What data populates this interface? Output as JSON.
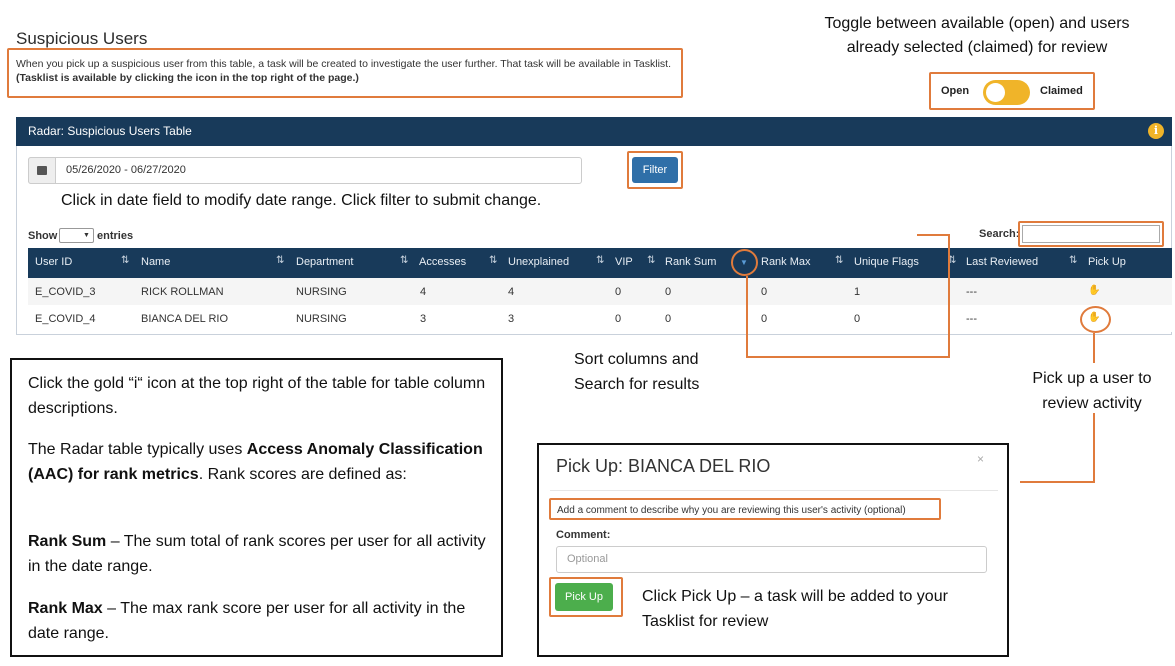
{
  "page": {
    "title": "Suspicious Users",
    "intro_line1": "When you pick up a suspicious user from this table, a task will be created to investigate the user further. That task will be available in Tasklist.",
    "intro_line2": "(Tasklist is available by clicking the icon in the top right of the page.)"
  },
  "toggle": {
    "callout": "Toggle between available (open) and users already selected (claimed) for review",
    "open_label": "Open",
    "claimed_label": "Claimed"
  },
  "panel": {
    "title": "Radar: Suspicious Users Table",
    "info_icon_glyph": "i"
  },
  "filters": {
    "date_range": "05/26/2020 - 06/27/2020",
    "filter_label": "Filter",
    "instructions": "Click in date field to modify date range.  Click filter to submit change."
  },
  "table_controls": {
    "show_label": "Show",
    "entries_label": "entries",
    "search_label": "Search:",
    "search_value": ""
  },
  "table": {
    "columns": [
      "User ID",
      "Name",
      "Department",
      "Accesses",
      "Unexplained",
      "VIP",
      "Rank Sum",
      "Rank Max",
      "Unique Flags",
      "Last Reviewed",
      "Pick Up"
    ],
    "rows": [
      {
        "user_id": "E_COVID_3",
        "name": "RICK ROLLMAN",
        "department": "NURSING",
        "accesses": "4",
        "unexplained": "4",
        "vip": "0",
        "rank_sum": "0",
        "rank_max": "0",
        "unique_flags": "1",
        "last_reviewed": "---"
      },
      {
        "user_id": "E_COVID_4",
        "name": "BIANCA DEL RIO",
        "department": "NURSING",
        "accesses": "3",
        "unexplained": "3",
        "vip": "0",
        "rank_sum": "0",
        "rank_max": "0",
        "unique_flags": "0",
        "last_reviewed": "---"
      }
    ]
  },
  "callouts": {
    "sort_line1": "Sort columns and",
    "sort_line2": "Search for results",
    "pickup_line1": "Pick up a user to",
    "pickup_line2": "review activity"
  },
  "notes": {
    "para1": "Click the gold “i“ icon at the top right of the table for table column descriptions.",
    "para2_pre": "The Radar table typically uses ",
    "para2_bold": "Access Anomaly Classification (AAC) for rank metrics",
    "para2_post": ".  Rank scores are defined as:",
    "para3_bold": "Rank Sum",
    "para3_text": " – The sum total of rank scores per user for all activity in the date range.",
    "para4_bold": "Rank Max",
    "para4_text": " – The max rank score per user for all activity in the date range."
  },
  "modal": {
    "title": "Pick Up: BIANCA DEL RIO",
    "close_glyph": "×",
    "description": "Add a comment to describe why you are reviewing this user's activity (optional)",
    "comment_label": "Comment:",
    "comment_placeholder": "Optional",
    "pickup_label": "Pick Up",
    "instructions": "Click Pick Up – a task will be added to your Tasklist for review"
  },
  "colors": {
    "accent_orange": "#e07b3c",
    "header_navy": "#183a5a",
    "toggle_gold": "#f0b429",
    "filter_blue": "#2f6fa8",
    "pickup_green": "#4cae4c"
  }
}
